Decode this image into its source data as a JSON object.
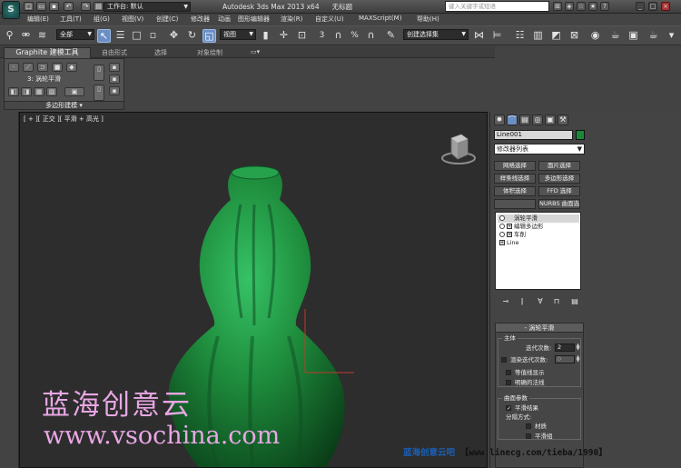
{
  "title_bar": {
    "workspace_label": "工作台: 默认",
    "app_name": "Autodesk 3ds Max  2013 x64",
    "file_name": "无标题",
    "search_placeholder": "键入关键字或短语",
    "app_logo": "3ds-max-logo"
  },
  "menu": [
    "编辑(E)",
    "工具(T)",
    "组(G)",
    "视图(V)",
    "创建(C)",
    "修改器",
    "动画",
    "图形编辑器",
    "渲染(R)",
    "自定义(U)",
    "MAXScript(M)",
    "帮助(H)"
  ],
  "toolbar": {
    "selection_filter": "全部",
    "ref_coord": "视图",
    "named_selection": "创建选择集"
  },
  "ribbon": {
    "tabs": [
      "Graphite 建模工具",
      "自由形式",
      "选择",
      "对象绘制"
    ],
    "panel_label": "涡轮平滑",
    "panel_prefix": "3:",
    "footer": "多边形建模"
  },
  "viewport": {
    "label": "[ + ][ 正交 ][ 平滑 + 高光 ]",
    "object_color": "#1e8c3c"
  },
  "command_panel": {
    "object_name": "Line001",
    "object_color": "#1a8a3a",
    "modifier_list": "修改器列表",
    "modifier_buttons": [
      "网格选择",
      "面片选择",
      "样条线选择",
      "多边形选择",
      "体积选择",
      "FFD 选择",
      "",
      "NURBS 曲面选择"
    ],
    "stack": [
      {
        "label": "涡轮平滑",
        "selected": true
      },
      {
        "label": "编辑多边形",
        "selected": false
      },
      {
        "label": "车削",
        "selected": false
      },
      {
        "label": "Line",
        "selected": false
      }
    ],
    "rollout": {
      "title": "涡轮平滑",
      "main_group": "主体",
      "iterations_label": "迭代次数:",
      "iterations_value": "2",
      "render_iters_label": "渲染迭代次数:",
      "render_iters_value": "0",
      "isoline_label": "等值线显示",
      "explicit_normals_label": "明确的法线",
      "surface_group": "曲面参数",
      "smooth_result_label": "平滑结果",
      "separate_by_label": "分隔方式:",
      "materials_label": "材质",
      "smoothing_groups_label": "平滑组"
    }
  },
  "watermark": {
    "line1": "蓝海创意云",
    "line2": "www.vsochina.com",
    "credit_a": "蓝海创意云吧",
    "credit_b": "【www.linecg.com/tieba/1990】"
  }
}
